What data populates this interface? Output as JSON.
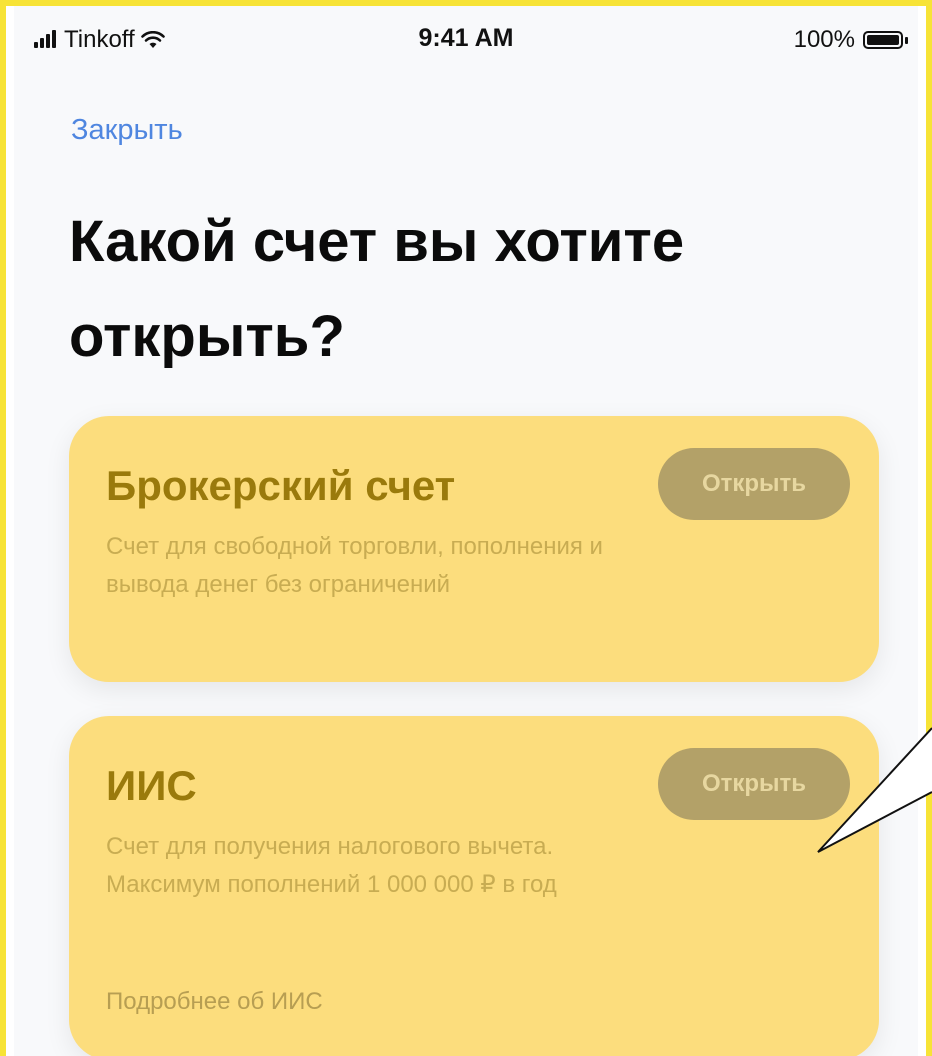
{
  "status_bar": {
    "carrier": "Tinkoff",
    "time": "9:41 AM",
    "battery": "100%"
  },
  "nav": {
    "close_label": "Закрыть"
  },
  "title": "Какой счет вы хотите открыть?",
  "accounts": [
    {
      "title": "Брокерский счет",
      "description": "Счет для свободной торговли, пополнения и вывода денег без ограничений",
      "button_label": "Открыть"
    },
    {
      "title": "ИИС",
      "description": "Счет для получения налогового вычета. Максимум пополнений 1 000 000 ₽ в год",
      "button_label": "Открыть",
      "more_link": "Подробнее об ИИС"
    }
  ],
  "colors": {
    "frame": "#f7e336",
    "card_background": "#fcdd7d",
    "card_title": "#9a7a0c",
    "button_background": "#b3a168",
    "link": "#4f86e0"
  },
  "icons": [
    "signal-icon",
    "wifi-icon",
    "battery-icon"
  ]
}
